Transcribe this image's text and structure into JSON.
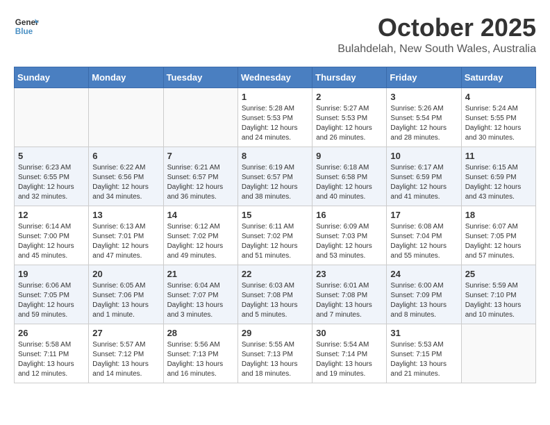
{
  "logo": {
    "line1": "General",
    "line2": "Blue"
  },
  "title": "October 2025",
  "location": "Bulahdelah, New South Wales, Australia",
  "weekdays": [
    "Sunday",
    "Monday",
    "Tuesday",
    "Wednesday",
    "Thursday",
    "Friday",
    "Saturday"
  ],
  "weeks": [
    [
      {
        "day": "",
        "detail": ""
      },
      {
        "day": "",
        "detail": ""
      },
      {
        "day": "",
        "detail": ""
      },
      {
        "day": "1",
        "detail": "Sunrise: 5:28 AM\nSunset: 5:53 PM\nDaylight: 12 hours\nand 24 minutes."
      },
      {
        "day": "2",
        "detail": "Sunrise: 5:27 AM\nSunset: 5:53 PM\nDaylight: 12 hours\nand 26 minutes."
      },
      {
        "day": "3",
        "detail": "Sunrise: 5:26 AM\nSunset: 5:54 PM\nDaylight: 12 hours\nand 28 minutes."
      },
      {
        "day": "4",
        "detail": "Sunrise: 5:24 AM\nSunset: 5:55 PM\nDaylight: 12 hours\nand 30 minutes."
      }
    ],
    [
      {
        "day": "5",
        "detail": "Sunrise: 6:23 AM\nSunset: 6:55 PM\nDaylight: 12 hours\nand 32 minutes."
      },
      {
        "day": "6",
        "detail": "Sunrise: 6:22 AM\nSunset: 6:56 PM\nDaylight: 12 hours\nand 34 minutes."
      },
      {
        "day": "7",
        "detail": "Sunrise: 6:21 AM\nSunset: 6:57 PM\nDaylight: 12 hours\nand 36 minutes."
      },
      {
        "day": "8",
        "detail": "Sunrise: 6:19 AM\nSunset: 6:57 PM\nDaylight: 12 hours\nand 38 minutes."
      },
      {
        "day": "9",
        "detail": "Sunrise: 6:18 AM\nSunset: 6:58 PM\nDaylight: 12 hours\nand 40 minutes."
      },
      {
        "day": "10",
        "detail": "Sunrise: 6:17 AM\nSunset: 6:59 PM\nDaylight: 12 hours\nand 41 minutes."
      },
      {
        "day": "11",
        "detail": "Sunrise: 6:15 AM\nSunset: 6:59 PM\nDaylight: 12 hours\nand 43 minutes."
      }
    ],
    [
      {
        "day": "12",
        "detail": "Sunrise: 6:14 AM\nSunset: 7:00 PM\nDaylight: 12 hours\nand 45 minutes."
      },
      {
        "day": "13",
        "detail": "Sunrise: 6:13 AM\nSunset: 7:01 PM\nDaylight: 12 hours\nand 47 minutes."
      },
      {
        "day": "14",
        "detail": "Sunrise: 6:12 AM\nSunset: 7:02 PM\nDaylight: 12 hours\nand 49 minutes."
      },
      {
        "day": "15",
        "detail": "Sunrise: 6:11 AM\nSunset: 7:02 PM\nDaylight: 12 hours\nand 51 minutes."
      },
      {
        "day": "16",
        "detail": "Sunrise: 6:09 AM\nSunset: 7:03 PM\nDaylight: 12 hours\nand 53 minutes."
      },
      {
        "day": "17",
        "detail": "Sunrise: 6:08 AM\nSunset: 7:04 PM\nDaylight: 12 hours\nand 55 minutes."
      },
      {
        "day": "18",
        "detail": "Sunrise: 6:07 AM\nSunset: 7:05 PM\nDaylight: 12 hours\nand 57 minutes."
      }
    ],
    [
      {
        "day": "19",
        "detail": "Sunrise: 6:06 AM\nSunset: 7:05 PM\nDaylight: 12 hours\nand 59 minutes."
      },
      {
        "day": "20",
        "detail": "Sunrise: 6:05 AM\nSunset: 7:06 PM\nDaylight: 13 hours\nand 1 minute."
      },
      {
        "day": "21",
        "detail": "Sunrise: 6:04 AM\nSunset: 7:07 PM\nDaylight: 13 hours\nand 3 minutes."
      },
      {
        "day": "22",
        "detail": "Sunrise: 6:03 AM\nSunset: 7:08 PM\nDaylight: 13 hours\nand 5 minutes."
      },
      {
        "day": "23",
        "detail": "Sunrise: 6:01 AM\nSunset: 7:08 PM\nDaylight: 13 hours\nand 7 minutes."
      },
      {
        "day": "24",
        "detail": "Sunrise: 6:00 AM\nSunset: 7:09 PM\nDaylight: 13 hours\nand 8 minutes."
      },
      {
        "day": "25",
        "detail": "Sunrise: 5:59 AM\nSunset: 7:10 PM\nDaylight: 13 hours\nand 10 minutes."
      }
    ],
    [
      {
        "day": "26",
        "detail": "Sunrise: 5:58 AM\nSunset: 7:11 PM\nDaylight: 13 hours\nand 12 minutes."
      },
      {
        "day": "27",
        "detail": "Sunrise: 5:57 AM\nSunset: 7:12 PM\nDaylight: 13 hours\nand 14 minutes."
      },
      {
        "day": "28",
        "detail": "Sunrise: 5:56 AM\nSunset: 7:13 PM\nDaylight: 13 hours\nand 16 minutes."
      },
      {
        "day": "29",
        "detail": "Sunrise: 5:55 AM\nSunset: 7:13 PM\nDaylight: 13 hours\nand 18 minutes."
      },
      {
        "day": "30",
        "detail": "Sunrise: 5:54 AM\nSunset: 7:14 PM\nDaylight: 13 hours\nand 19 minutes."
      },
      {
        "day": "31",
        "detail": "Sunrise: 5:53 AM\nSunset: 7:15 PM\nDaylight: 13 hours\nand 21 minutes."
      },
      {
        "day": "",
        "detail": ""
      }
    ]
  ]
}
